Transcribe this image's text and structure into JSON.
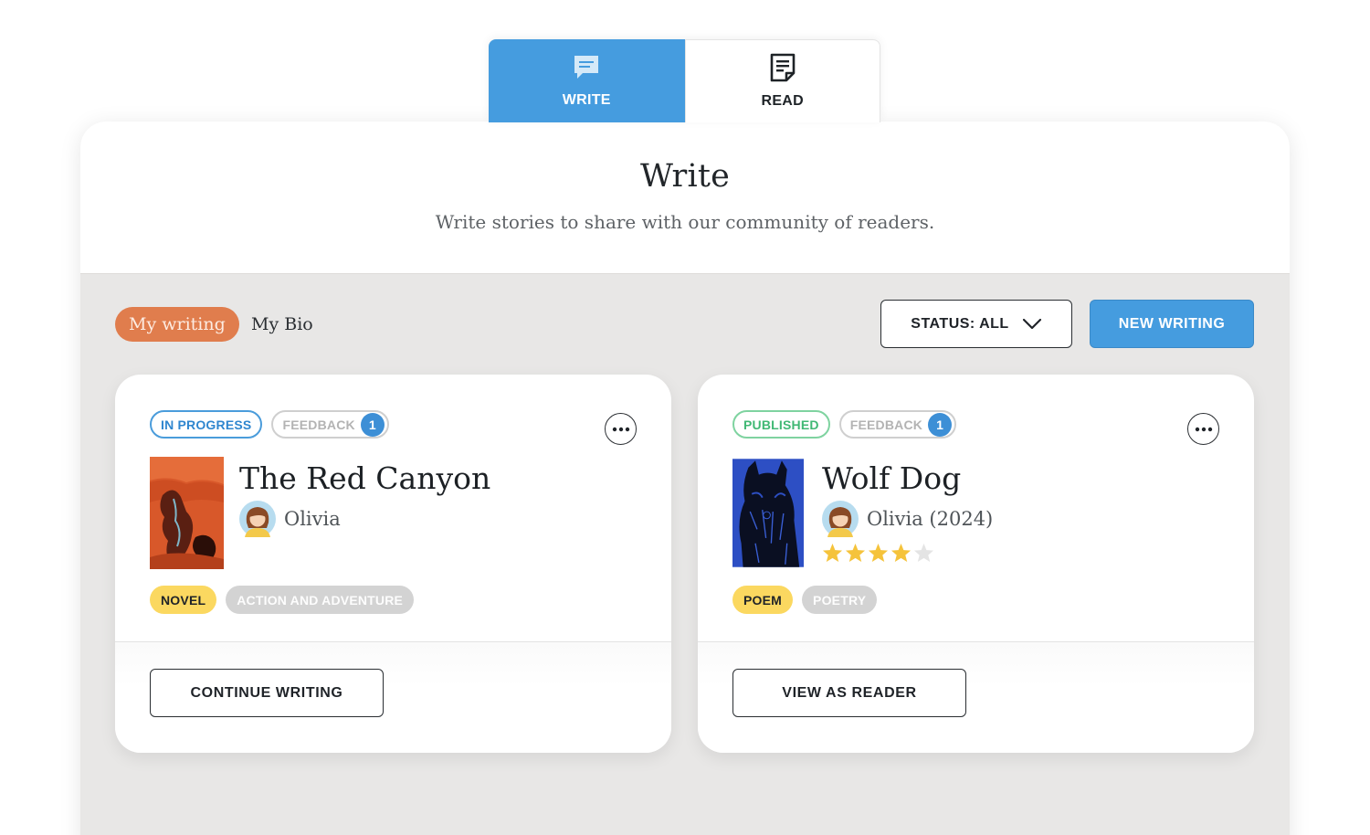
{
  "tabs": {
    "write_label": "WRITE",
    "read_label": "READ"
  },
  "header": {
    "title": "Write",
    "subtitle": "Write stories to share with our community of readers."
  },
  "toolbar": {
    "my_writing_label": "My writing",
    "my_bio_label": "My Bio",
    "status_label": "STATUS: ALL",
    "new_writing_label": "NEW WRITING"
  },
  "cards": [
    {
      "status": "IN PROGRESS",
      "feedback_label": "FEEDBACK",
      "feedback_count": "1",
      "title": "The Red Canyon",
      "author": "Olivia",
      "genre_primary": "NOVEL",
      "genre_secondary": "ACTION AND ADVENTURE",
      "action_label": "CONTINUE WRITING"
    },
    {
      "status": "PUBLISHED",
      "feedback_label": "FEEDBACK",
      "feedback_count": "1",
      "title": "Wolf Dog",
      "author": "Olivia (2024)",
      "rating": 4,
      "rating_max": 5,
      "genre_primary": "POEM",
      "genre_secondary": "POETRY",
      "action_label": "VIEW AS READER"
    }
  ],
  "colors": {
    "accent_blue": "#459cdf",
    "accent_orange": "#e07d4d",
    "published_green": "#40b874",
    "genre_yellow": "#fbd860",
    "star_gold": "#f5c33b"
  }
}
